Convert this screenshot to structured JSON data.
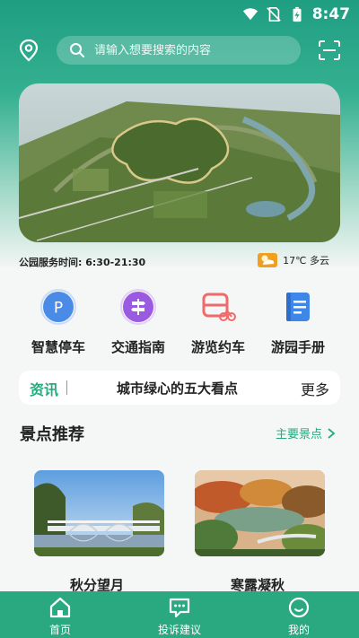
{
  "status_bar": {
    "time": "8:47"
  },
  "search": {
    "placeholder": "请输入想要搜索的内容"
  },
  "park": {
    "hours_label": "公园服务时间:",
    "hours": "6:30-21:30",
    "weather": "17℃ 多云"
  },
  "quick_actions": [
    {
      "label": "智慧停车",
      "icon": "parking-icon"
    },
    {
      "label": "交通指南",
      "icon": "signpost-icon"
    },
    {
      "label": "游览约车",
      "icon": "tour-vehicle-icon"
    },
    {
      "label": "游园手册",
      "icon": "handbook-icon"
    }
  ],
  "news": {
    "tag": "资讯",
    "headline": "城市绿心的五大看点",
    "more": "更多"
  },
  "spots": {
    "title": "景点推荐",
    "more": "主要景点",
    "items": [
      {
        "name": "秋分望月"
      },
      {
        "name": "寒露凝秋"
      }
    ]
  },
  "nav": {
    "items": [
      {
        "label": "首页"
      },
      {
        "label": "投诉建议"
      },
      {
        "label": "我的"
      }
    ]
  },
  "colors": {
    "accent": "#2aa981",
    "parking": "#4a8be8",
    "guide": "#9a5be0",
    "tour": "#f06a6a",
    "handbook": "#3e86e8"
  }
}
